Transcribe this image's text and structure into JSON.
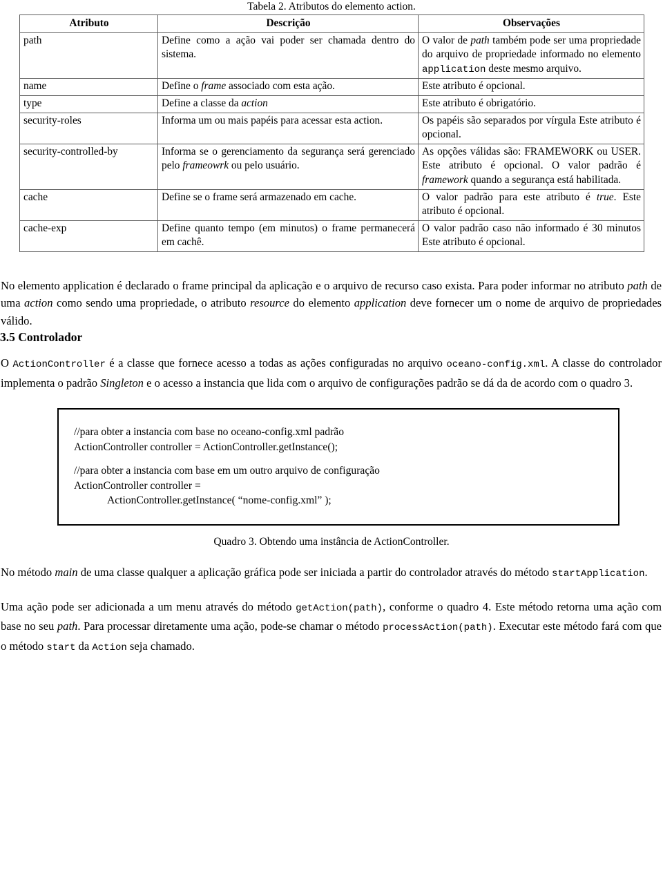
{
  "table": {
    "caption": "Tabela 2. Atributos do elemento action.",
    "headers": [
      "Atributo",
      "Descrição",
      "Observações"
    ],
    "rows": [
      {
        "attribute": "path",
        "description_parts": [
          {
            "t": "Define como a ação vai poder ser chamada dentro do sistema.",
            "s": "normal"
          }
        ],
        "notes_parts": [
          {
            "t": "O valor de ",
            "s": "normal"
          },
          {
            "t": "path",
            "s": "italic"
          },
          {
            "t": " também pode ser uma propriedade do arquivo de propriedade informado no elemento ",
            "s": "normal"
          },
          {
            "t": "application",
            "s": "mono"
          },
          {
            "t": " deste mesmo arquivo.",
            "s": "normal"
          }
        ]
      },
      {
        "attribute": "name",
        "description_parts": [
          {
            "t": "Define o ",
            "s": "normal"
          },
          {
            "t": "frame",
            "s": "italic"
          },
          {
            "t": " associado com esta ação.",
            "s": "normal"
          }
        ],
        "notes_parts": [
          {
            "t": "Este atributo é opcional.",
            "s": "normal"
          }
        ]
      },
      {
        "attribute": "type",
        "description_parts": [
          {
            "t": "Define a classe da ",
            "s": "normal"
          },
          {
            "t": "action",
            "s": "italic"
          }
        ],
        "notes_parts": [
          {
            "t": "Este atributo é obrigatório.",
            "s": "normal"
          }
        ]
      },
      {
        "attribute": "security-roles",
        "description_parts": [
          {
            "t": "Informa um ou mais papéis para acessar esta action.",
            "s": "normal"
          }
        ],
        "notes_parts": [
          {
            "t": "Os papéis são separados por vírgula Este atributo é opcional.",
            "s": "normal"
          }
        ]
      },
      {
        "attribute": "security-controlled-by",
        "description_parts": [
          {
            "t": "Informa se o gerenciamento da segurança será gerenciado pelo ",
            "s": "normal"
          },
          {
            "t": "frameowrk",
            "s": "italic"
          },
          {
            "t": " ou pelo usuário.",
            "s": "normal"
          }
        ],
        "notes_parts": [
          {
            "t": "As opções válidas são: FRAMEWORK ou USER. Este atributo é opcional. O valor padrão é ",
            "s": "normal"
          },
          {
            "t": "framework",
            "s": "italic"
          },
          {
            "t": " quando a segurança está habilitada.",
            "s": "normal"
          }
        ]
      },
      {
        "attribute": "cache",
        "description_parts": [
          {
            "t": "Define se o frame será armazenado em cache.",
            "s": "normal"
          }
        ],
        "notes_parts": [
          {
            "t": "O valor padrão para este atributo é ",
            "s": "normal"
          },
          {
            "t": "true",
            "s": "italic"
          },
          {
            "t": ". Este atributo é opcional.",
            "s": "normal"
          }
        ]
      },
      {
        "attribute": "cache-exp",
        "description_parts": [
          {
            "t": "Define quanto tempo (em minutos) o frame permanecerá em cachê.",
            "s": "normal"
          }
        ],
        "notes_parts": [
          {
            "t": "O valor padrão caso não informado é 30 minutos Este atributo é opcional.",
            "s": "normal"
          }
        ]
      }
    ]
  },
  "paragraph_application": [
    {
      "t": "No elemento application é declarado o frame principal da aplicação e o arquivo de recurso caso exista. Para poder informar no atributo ",
      "s": "normal"
    },
    {
      "t": "path",
      "s": "italic"
    },
    {
      "t": " de uma ",
      "s": "normal"
    },
    {
      "t": "action",
      "s": "italic"
    },
    {
      "t": " como sendo uma propriedade, o atributo ",
      "s": "normal"
    },
    {
      "t": "resource",
      "s": "italic"
    },
    {
      "t": " do elemento ",
      "s": "normal"
    },
    {
      "t": "application",
      "s": "italic"
    },
    {
      "t": " deve fornecer um o nome de arquivo de propriedades válido.",
      "s": "normal"
    }
  ],
  "section": {
    "heading": "3.5 Controlador",
    "paragraph": [
      {
        "t": "O ",
        "s": "normal"
      },
      {
        "t": "ActionController",
        "s": "mono"
      },
      {
        "t": " é a classe que fornece acesso a todas as ações configuradas no arquivo ",
        "s": "normal"
      },
      {
        "t": "oceano-config.xml",
        "s": "mono"
      },
      {
        "t": ". A classe do controlador implementa o padrão ",
        "s": "normal"
      },
      {
        "t": "Singleton",
        "s": "italic"
      },
      {
        "t": " e o acesso a instancia que lida com o arquivo de configurações padrão se dá da de acordo com o quadro 3.",
        "s": "normal"
      }
    ]
  },
  "code_box": {
    "line1": "//para obter a instancia com base no oceano-config.xml padrão",
    "line2": "ActionController controller = ActionController.getInstance();",
    "line3": "//para obter a instancia com base em um outro arquivo de configuração",
    "line4": "ActionController controller =",
    "line5": "ActionController.getInstance( “nome-config.xml” );"
  },
  "quadro_caption": "Quadro 3. Obtendo uma instância de ActionController.",
  "paragraph_main": [
    {
      "t": "No método ",
      "s": "normal"
    },
    {
      "t": "main",
      "s": "italic"
    },
    {
      "t": " de uma classe qualquer a aplicação gráfica pode ser iniciada a partir do controlador através do método ",
      "s": "normal"
    },
    {
      "t": "startApplication",
      "s": "mono"
    },
    {
      "t": ".",
      "s": "normal"
    }
  ],
  "paragraph_acao": [
    {
      "t": "Uma ação pode ser adicionada a um menu através do método ",
      "s": "normal"
    },
    {
      "t": "getAction(path)",
      "s": "mono"
    },
    {
      "t": ", conforme o quadro 4. Este método retorna uma ação com base no seu ",
      "s": "normal"
    },
    {
      "t": "path",
      "s": "italic"
    },
    {
      "t": ". Para processar diretamente uma ação, pode-se chamar o método ",
      "s": "normal"
    },
    {
      "t": "processAction(path)",
      "s": "mono"
    },
    {
      "t": ". Executar este método fará com que o método ",
      "s": "normal"
    },
    {
      "t": "start",
      "s": "mono"
    },
    {
      "t": " da ",
      "s": "normal"
    },
    {
      "t": "Action",
      "s": "mono"
    },
    {
      "t": " seja chamado.",
      "s": "normal"
    }
  ]
}
